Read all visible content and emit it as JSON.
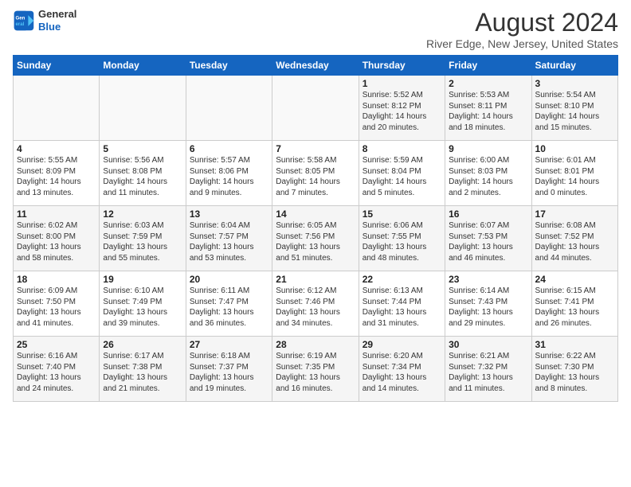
{
  "header": {
    "logo_line1": "General",
    "logo_line2": "Blue",
    "main_title": "August 2024",
    "subtitle": "River Edge, New Jersey, United States"
  },
  "weekdays": [
    "Sunday",
    "Monday",
    "Tuesday",
    "Wednesday",
    "Thursday",
    "Friday",
    "Saturday"
  ],
  "weeks": [
    [
      {
        "day": "",
        "info": ""
      },
      {
        "day": "",
        "info": ""
      },
      {
        "day": "",
        "info": ""
      },
      {
        "day": "",
        "info": ""
      },
      {
        "day": "1",
        "info": "Sunrise: 5:52 AM\nSunset: 8:12 PM\nDaylight: 14 hours and 20 minutes."
      },
      {
        "day": "2",
        "info": "Sunrise: 5:53 AM\nSunset: 8:11 PM\nDaylight: 14 hours and 18 minutes."
      },
      {
        "day": "3",
        "info": "Sunrise: 5:54 AM\nSunset: 8:10 PM\nDaylight: 14 hours and 15 minutes."
      }
    ],
    [
      {
        "day": "4",
        "info": "Sunrise: 5:55 AM\nSunset: 8:09 PM\nDaylight: 14 hours and 13 minutes."
      },
      {
        "day": "5",
        "info": "Sunrise: 5:56 AM\nSunset: 8:08 PM\nDaylight: 14 hours and 11 minutes."
      },
      {
        "day": "6",
        "info": "Sunrise: 5:57 AM\nSunset: 8:06 PM\nDaylight: 14 hours and 9 minutes."
      },
      {
        "day": "7",
        "info": "Sunrise: 5:58 AM\nSunset: 8:05 PM\nDaylight: 14 hours and 7 minutes."
      },
      {
        "day": "8",
        "info": "Sunrise: 5:59 AM\nSunset: 8:04 PM\nDaylight: 14 hours and 5 minutes."
      },
      {
        "day": "9",
        "info": "Sunrise: 6:00 AM\nSunset: 8:03 PM\nDaylight: 14 hours and 2 minutes."
      },
      {
        "day": "10",
        "info": "Sunrise: 6:01 AM\nSunset: 8:01 PM\nDaylight: 14 hours and 0 minutes."
      }
    ],
    [
      {
        "day": "11",
        "info": "Sunrise: 6:02 AM\nSunset: 8:00 PM\nDaylight: 13 hours and 58 minutes."
      },
      {
        "day": "12",
        "info": "Sunrise: 6:03 AM\nSunset: 7:59 PM\nDaylight: 13 hours and 55 minutes."
      },
      {
        "day": "13",
        "info": "Sunrise: 6:04 AM\nSunset: 7:57 PM\nDaylight: 13 hours and 53 minutes."
      },
      {
        "day": "14",
        "info": "Sunrise: 6:05 AM\nSunset: 7:56 PM\nDaylight: 13 hours and 51 minutes."
      },
      {
        "day": "15",
        "info": "Sunrise: 6:06 AM\nSunset: 7:55 PM\nDaylight: 13 hours and 48 minutes."
      },
      {
        "day": "16",
        "info": "Sunrise: 6:07 AM\nSunset: 7:53 PM\nDaylight: 13 hours and 46 minutes."
      },
      {
        "day": "17",
        "info": "Sunrise: 6:08 AM\nSunset: 7:52 PM\nDaylight: 13 hours and 44 minutes."
      }
    ],
    [
      {
        "day": "18",
        "info": "Sunrise: 6:09 AM\nSunset: 7:50 PM\nDaylight: 13 hours and 41 minutes."
      },
      {
        "day": "19",
        "info": "Sunrise: 6:10 AM\nSunset: 7:49 PM\nDaylight: 13 hours and 39 minutes."
      },
      {
        "day": "20",
        "info": "Sunrise: 6:11 AM\nSunset: 7:47 PM\nDaylight: 13 hours and 36 minutes."
      },
      {
        "day": "21",
        "info": "Sunrise: 6:12 AM\nSunset: 7:46 PM\nDaylight: 13 hours and 34 minutes."
      },
      {
        "day": "22",
        "info": "Sunrise: 6:13 AM\nSunset: 7:44 PM\nDaylight: 13 hours and 31 minutes."
      },
      {
        "day": "23",
        "info": "Sunrise: 6:14 AM\nSunset: 7:43 PM\nDaylight: 13 hours and 29 minutes."
      },
      {
        "day": "24",
        "info": "Sunrise: 6:15 AM\nSunset: 7:41 PM\nDaylight: 13 hours and 26 minutes."
      }
    ],
    [
      {
        "day": "25",
        "info": "Sunrise: 6:16 AM\nSunset: 7:40 PM\nDaylight: 13 hours and 24 minutes."
      },
      {
        "day": "26",
        "info": "Sunrise: 6:17 AM\nSunset: 7:38 PM\nDaylight: 13 hours and 21 minutes."
      },
      {
        "day": "27",
        "info": "Sunrise: 6:18 AM\nSunset: 7:37 PM\nDaylight: 13 hours and 19 minutes."
      },
      {
        "day": "28",
        "info": "Sunrise: 6:19 AM\nSunset: 7:35 PM\nDaylight: 13 hours and 16 minutes."
      },
      {
        "day": "29",
        "info": "Sunrise: 6:20 AM\nSunset: 7:34 PM\nDaylight: 13 hours and 14 minutes."
      },
      {
        "day": "30",
        "info": "Sunrise: 6:21 AM\nSunset: 7:32 PM\nDaylight: 13 hours and 11 minutes."
      },
      {
        "day": "31",
        "info": "Sunrise: 6:22 AM\nSunset: 7:30 PM\nDaylight: 13 hours and 8 minutes."
      }
    ]
  ]
}
